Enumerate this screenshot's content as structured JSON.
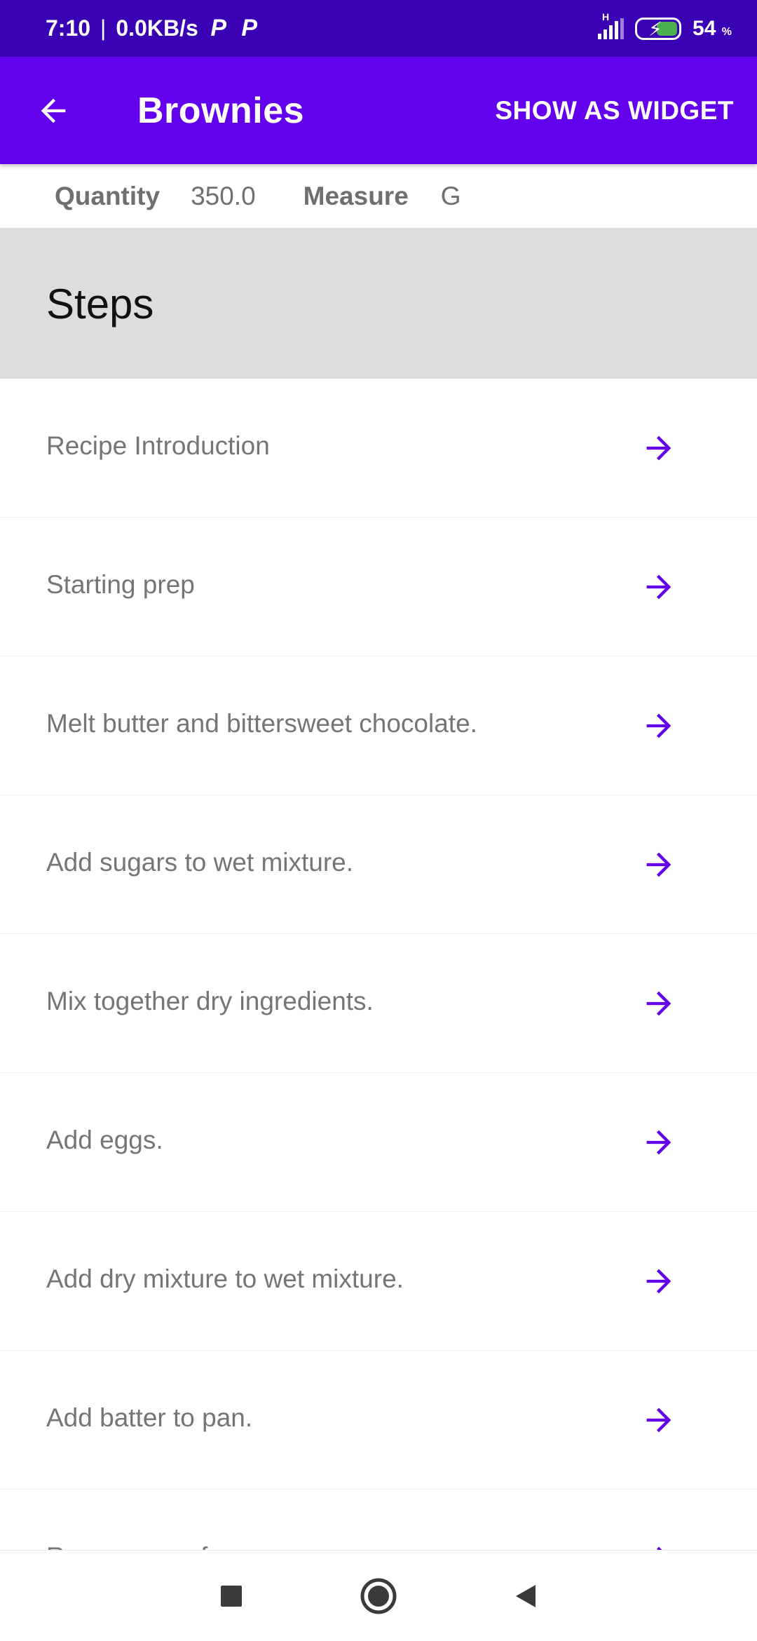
{
  "status_bar": {
    "time": "7:10",
    "network_speed": "0.0KB/s",
    "notification_icons": [
      "P",
      "P"
    ],
    "signal_label": "H",
    "battery_percent": "54",
    "battery_unit": "%"
  },
  "app_bar": {
    "title": "Brownies",
    "back_icon": "arrow-left-icon",
    "action_label": "SHOW AS WIDGET"
  },
  "ingredient": {
    "quantity_label": "Quantity",
    "quantity_value": "350.0",
    "measure_label": "Measure",
    "measure_value": "G"
  },
  "steps": {
    "title": "Steps",
    "items": [
      {
        "label": "Recipe Introduction"
      },
      {
        "label": "Starting prep"
      },
      {
        "label": "Melt butter and bittersweet chocolate."
      },
      {
        "label": "Add sugars to wet mixture."
      },
      {
        "label": "Mix together dry ingredients."
      },
      {
        "label": "Add eggs."
      },
      {
        "label": "Add dry mixture to wet mixture."
      },
      {
        "label": "Add batter to pan."
      },
      {
        "label": "Remove pan from oven."
      }
    ],
    "item_icon": "arrow-right-icon"
  },
  "colors": {
    "status_bar": "#3a00b4",
    "app_bar": "#6200ee",
    "accent": "#6200ee",
    "steps_header_bg": "#dddddd"
  },
  "nav_bar": {
    "icons": [
      "recents-square-icon",
      "home-circle-icon",
      "back-triangle-icon"
    ]
  }
}
